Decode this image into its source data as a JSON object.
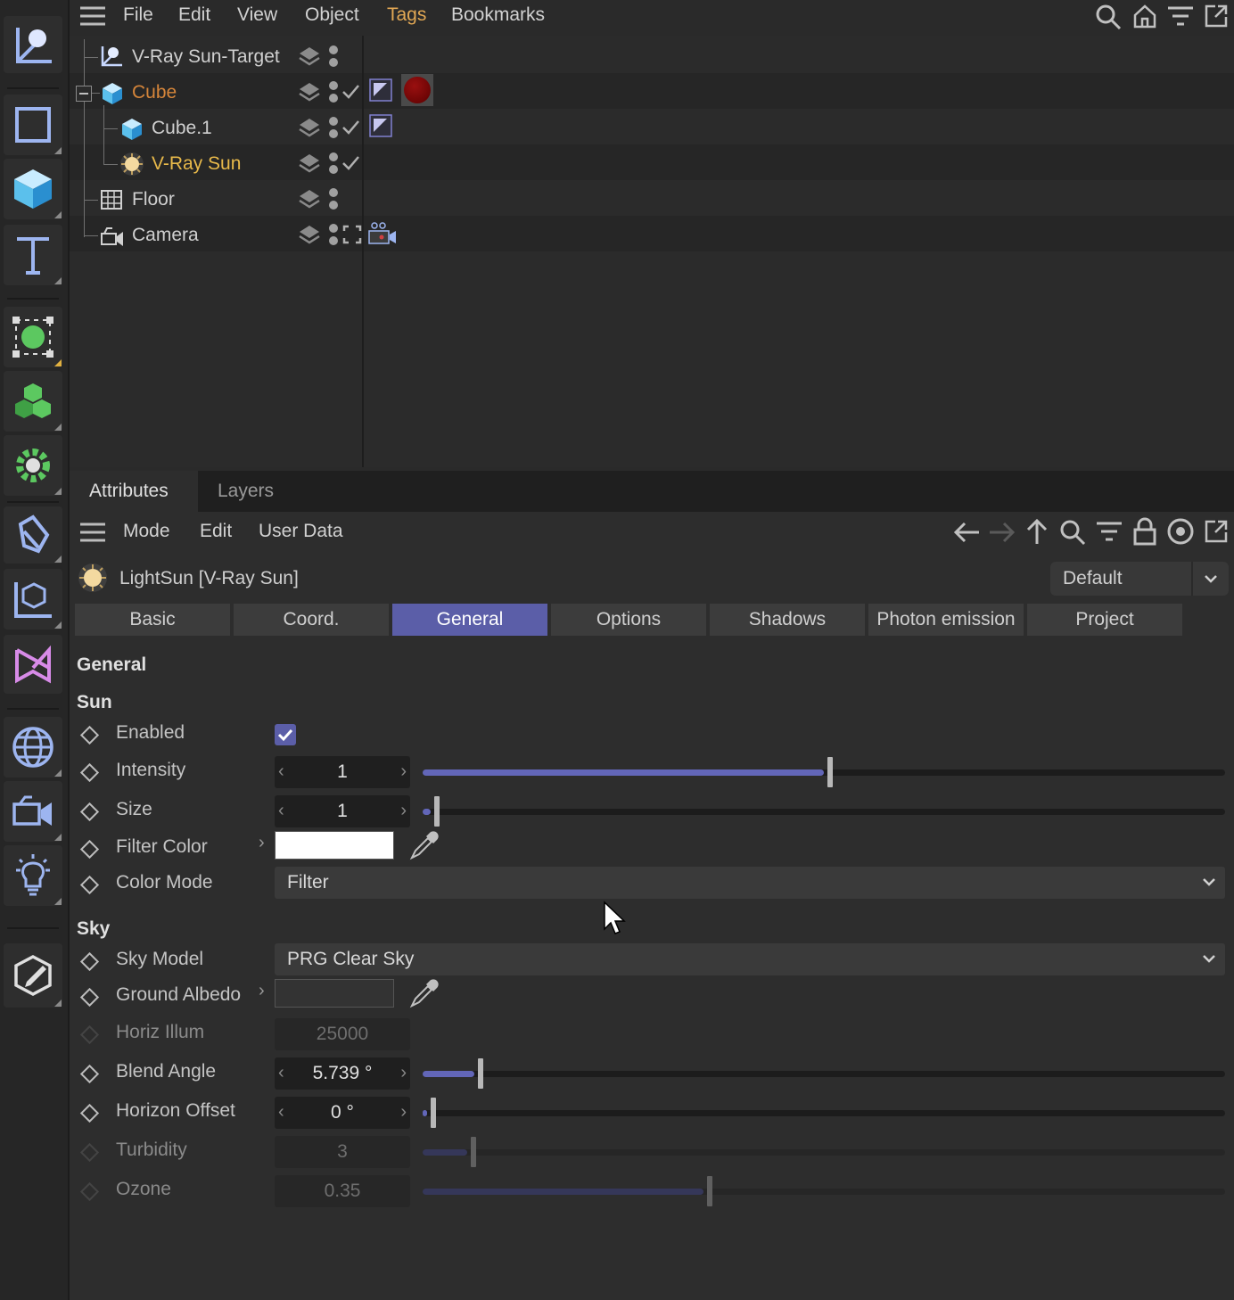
{
  "menubar": {
    "items": [
      "File",
      "Edit",
      "View",
      "Object",
      "Tags",
      "Bookmarks"
    ],
    "highlighted": "Tags"
  },
  "objects": [
    {
      "name": "V-Ray Sun-Target",
      "color": "#d0d0d0",
      "icon": "target-icon"
    },
    {
      "name": "Cube",
      "color": "#d5853a",
      "icon": "cube-icon"
    },
    {
      "name": "Cube.1",
      "color": "#d0d0d0",
      "icon": "cube-icon"
    },
    {
      "name": "V-Ray Sun",
      "color": "#e8b94a",
      "icon": "sun-icon"
    },
    {
      "name": "Floor",
      "color": "#d0d0d0",
      "icon": "floor-icon"
    },
    {
      "name": "Camera",
      "color": "#d0d0d0",
      "icon": "camera-icon"
    }
  ],
  "panel_tabs": [
    "Attributes",
    "Layers"
  ],
  "attr_menu": [
    "Mode",
    "Edit",
    "User Data"
  ],
  "object_header": {
    "name": "LightSun [V-Ray Sun]",
    "preset": "Default"
  },
  "subtabs": [
    "Basic",
    "Coord.",
    "General",
    "Options",
    "Shadows",
    "Photon emission",
    "Project"
  ],
  "active_subtab": "General",
  "section_general": "General",
  "sun": {
    "title": "Sun",
    "enabled": {
      "label": "Enabled",
      "checked": true
    },
    "intensity": {
      "label": "Intensity",
      "value": "1",
      "fraction": 0.5
    },
    "size": {
      "label": "Size",
      "value": "1",
      "fraction": 0.01
    },
    "filter_color": {
      "label": "Filter Color",
      "color": "#ffffff"
    },
    "color_mode": {
      "label": "Color Mode",
      "value": "Filter"
    }
  },
  "sky": {
    "title": "Sky",
    "sky_model": {
      "label": "Sky Model",
      "value": "PRG Clear Sky"
    },
    "ground_albedo": {
      "label": "Ground Albedo",
      "color": "#333333"
    },
    "horiz_illum": {
      "label": "Horiz Illum",
      "value": "25000"
    },
    "blend_angle": {
      "label": "Blend Angle",
      "value": "5.739 °",
      "fraction": 0.064
    },
    "horizon_offset": {
      "label": "Horizon Offset",
      "value": "0 °",
      "fraction": 0.005
    },
    "turbidity": {
      "label": "Turbidity",
      "value": "3",
      "fraction": 0.055
    },
    "ozone": {
      "label": "Ozone",
      "value": "0.35",
      "fraction": 0.35
    }
  },
  "colors": {
    "accent": "#5b5ea8",
    "slider": "#6266b8",
    "orange": "#d5853a",
    "yellow": "#e8b94a"
  }
}
